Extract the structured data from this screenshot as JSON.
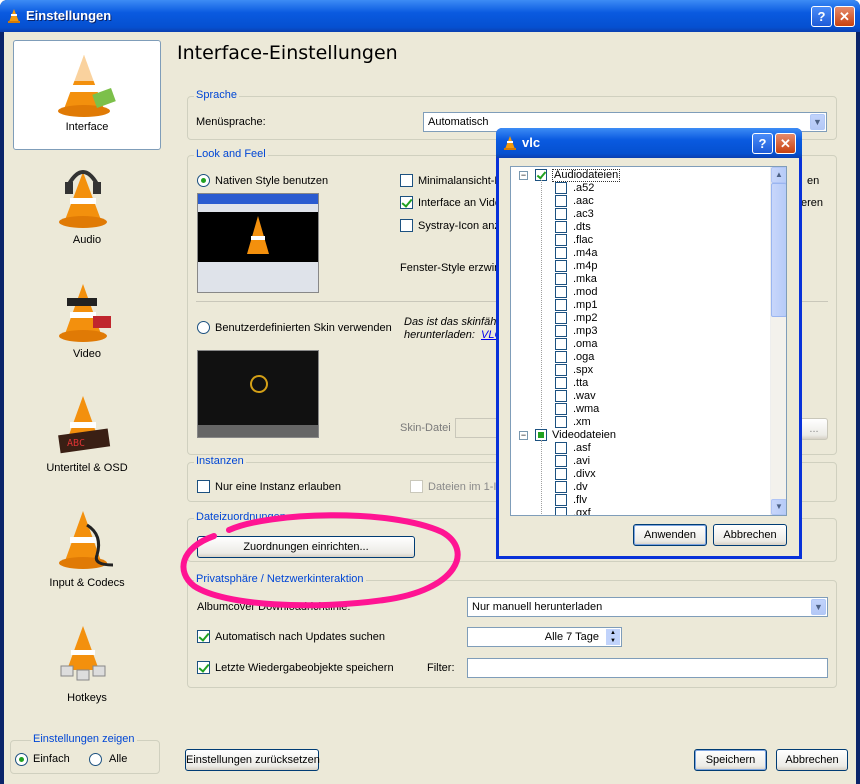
{
  "window": {
    "title": "Einstellungen",
    "help_btn": "?",
    "close_btn": "✕"
  },
  "sidebar": {
    "items": [
      {
        "label": "Interface",
        "icon": "vlc-cone-interface-icon"
      },
      {
        "label": "Audio",
        "icon": "vlc-cone-headphones-icon"
      },
      {
        "label": "Video",
        "icon": "vlc-cone-glasses-icon"
      },
      {
        "label": "Untertitel & OSD",
        "icon": "vlc-cone-subtitle-icon"
      },
      {
        "label": "Input & Codecs",
        "icon": "vlc-cone-cable-icon"
      },
      {
        "label": "Hotkeys",
        "icon": "vlc-cone-keys-icon"
      }
    ],
    "show_settings": {
      "title": "Einstellungen zeigen",
      "simple": "Einfach",
      "all": "Alle"
    }
  },
  "main": {
    "title": "Interface-Einstellungen",
    "sprache": {
      "title": "Sprache",
      "menu_label": "Menüsprache:",
      "menu_value": "Automatisch"
    },
    "look": {
      "title": "Look and Feel",
      "native_style": "Nativen Style benutzen",
      "minimal": "Minimalansicht-M",
      "minimal_tail": "en",
      "video_fit": "Interface an Vide",
      "video_fit_tail": "eren",
      "systray": "Systray-Icon anz",
      "window_style": "Fenster-Style erzwin",
      "custom_skin": "Benutzerdefinierten Skin verwenden",
      "skin_hint_1": "Das ist das skinfähi",
      "skin_hint_2": "herunterladen:",
      "skin_hint_link": "VLC",
      "skin_file": "Skin-Datei",
      "browse": "..."
    },
    "instances": {
      "title": "Instanzen",
      "single": "Nur eine Instanz erlauben",
      "queue": "Dateien im 1-I"
    },
    "file_assoc": {
      "title": "Dateizuordnungen",
      "button": "Zuordnungen einrichten..."
    },
    "privacy": {
      "title": "Privatsphäre / Netzwerkinteraktion",
      "album_label": "Albumcover Downloadrichtlinie:",
      "album_value": "Nur manuell herunterladen",
      "updates": "Automatisch nach Updates suchen",
      "updates_value": "Alle 7 Tage",
      "recent": "Letzte Wiedergabeobjekte speichern",
      "filter_label": "Filter:"
    }
  },
  "footer": {
    "reset": "Einstellungen zurücksetzen",
    "save": "Speichern",
    "cancel": "Abbrechen"
  },
  "dialog": {
    "title": "vlc",
    "help_btn": "?",
    "close_btn": "✕",
    "audio_group": "Audiodateien",
    "audio_ext": [
      ".a52",
      ".aac",
      ".ac3",
      ".dts",
      ".flac",
      ".m4a",
      ".m4p",
      ".mka",
      ".mod",
      ".mp1",
      ".mp2",
      ".mp3",
      ".oma",
      ".oga",
      ".spx",
      ".tta",
      ".wav",
      ".wma",
      ".xm"
    ],
    "video_group": "Videodateien",
    "video_ext": [
      ".asf",
      ".avi",
      ".divx",
      ".dv",
      ".flv",
      ".gxf"
    ],
    "apply": "Anwenden",
    "cancel": "Abbrechen"
  },
  "colors": {
    "accent": "#0046d5",
    "annotation": "#ff1493",
    "check": "#21a121"
  }
}
